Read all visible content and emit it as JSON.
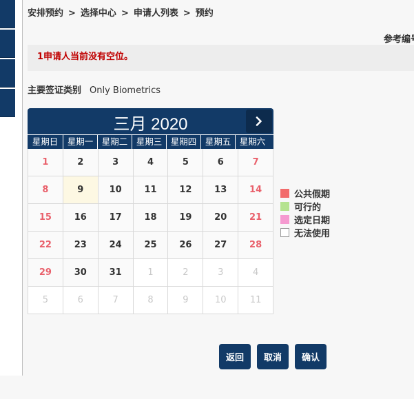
{
  "breadcrumb": [
    "安排预约",
    "选择中心",
    "申请人列表",
    "预约"
  ],
  "breadcrumb_sep": ">",
  "reference_label": "参考编号",
  "alert": {
    "message": "1申请人当前没有空位。",
    "color": "#c00000"
  },
  "visa": {
    "label": "主要签证类别",
    "value": "Only Biometrics"
  },
  "calendar": {
    "title": "三月 2020",
    "next_icon": "chevron-right-icon",
    "weekdays": [
      "星期日",
      "星期一",
      "星期二",
      "星期三",
      "星期四",
      "星期五",
      "星期六"
    ],
    "weeks": [
      [
        {
          "d": "1",
          "s": "holiday"
        },
        {
          "d": "2",
          "s": ""
        },
        {
          "d": "3",
          "s": ""
        },
        {
          "d": "4",
          "s": ""
        },
        {
          "d": "5",
          "s": ""
        },
        {
          "d": "6",
          "s": ""
        },
        {
          "d": "7",
          "s": "holiday"
        }
      ],
      [
        {
          "d": "8",
          "s": "holiday"
        },
        {
          "d": "9",
          "s": "today"
        },
        {
          "d": "10",
          "s": ""
        },
        {
          "d": "11",
          "s": ""
        },
        {
          "d": "12",
          "s": ""
        },
        {
          "d": "13",
          "s": ""
        },
        {
          "d": "14",
          "s": "holiday"
        }
      ],
      [
        {
          "d": "15",
          "s": "holiday"
        },
        {
          "d": "16",
          "s": ""
        },
        {
          "d": "17",
          "s": ""
        },
        {
          "d": "18",
          "s": ""
        },
        {
          "d": "19",
          "s": ""
        },
        {
          "d": "20",
          "s": ""
        },
        {
          "d": "21",
          "s": "holiday"
        }
      ],
      [
        {
          "d": "22",
          "s": "holiday"
        },
        {
          "d": "23",
          "s": ""
        },
        {
          "d": "24",
          "s": ""
        },
        {
          "d": "25",
          "s": ""
        },
        {
          "d": "26",
          "s": ""
        },
        {
          "d": "27",
          "s": ""
        },
        {
          "d": "28",
          "s": "holiday"
        }
      ],
      [
        {
          "d": "29",
          "s": "holiday"
        },
        {
          "d": "30",
          "s": ""
        },
        {
          "d": "31",
          "s": ""
        },
        {
          "d": "1",
          "s": "muted"
        },
        {
          "d": "2",
          "s": "muted"
        },
        {
          "d": "3",
          "s": "muted"
        },
        {
          "d": "4",
          "s": "muted"
        }
      ],
      [
        {
          "d": "5",
          "s": "muted"
        },
        {
          "d": "6",
          "s": "muted"
        },
        {
          "d": "7",
          "s": "muted"
        },
        {
          "d": "8",
          "s": "muted"
        },
        {
          "d": "9",
          "s": "muted"
        },
        {
          "d": "10",
          "s": "muted"
        },
        {
          "d": "11",
          "s": "muted"
        }
      ]
    ]
  },
  "legend": [
    {
      "label": "公共假期",
      "color": "#f26b6b",
      "border": "#f26b6b"
    },
    {
      "label": "可行的",
      "color": "#b5e38f",
      "border": "#b5e38f"
    },
    {
      "label": "选定日期",
      "color": "#f59ad0",
      "border": "#f59ad0"
    },
    {
      "label": "无法使用",
      "color": "#ffffff",
      "border": "#999999"
    }
  ],
  "buttons": {
    "back": "返回",
    "cancel": "取消",
    "confirm": "确认"
  },
  "colors": {
    "primary": "#123a67",
    "holiday_text": "#e9606b",
    "today_bg": "#fdf8e3"
  }
}
